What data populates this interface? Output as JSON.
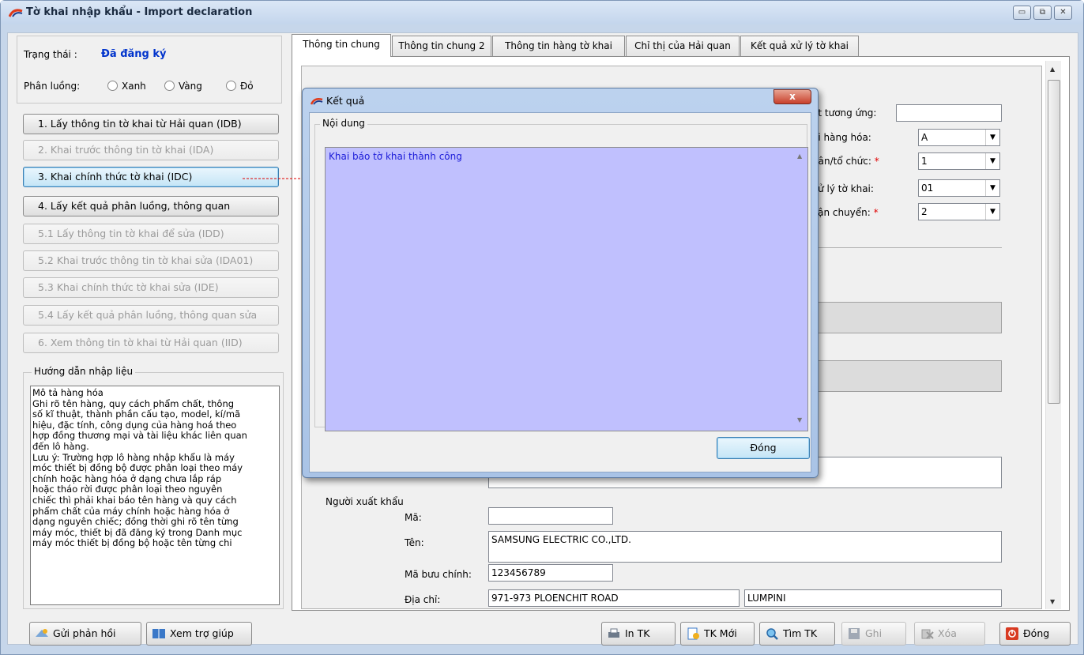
{
  "window": {
    "title": "Tờ khai nhập khẩu - Import declaration",
    "buttons": [
      "▭",
      "⧉",
      "✕"
    ]
  },
  "status": {
    "label": "Trạng thái :",
    "value": "Đã đăng ký",
    "routing_label": "Phân luồng:",
    "options": [
      "Xanh",
      "Vàng",
      "Đỏ"
    ]
  },
  "actions": [
    "1. Lấy thông tin tờ khai từ Hải quan (IDB)",
    "2. Khai trước thông tin tờ khai (IDA)",
    "3. Khai chính thức tờ khai (IDC)",
    "4. Lấy kết quả phân luồng, thông quan",
    "5.1 Lấy thông tin tờ khai để sửa (IDD)",
    "5.2 Khai trước thông tin tờ khai sửa (IDA01)",
    "5.3 Khai chính thức tờ khai sửa (IDE)",
    "5.4 Lấy kết quả phân luồng, thông quan sửa",
    "6. Xem thông tin tờ khai từ Hải quan (IID)"
  ],
  "guide": {
    "title": "Hướng dẫn nhập liệu",
    "text": "Mô tả hàng hóa\nGhi rõ tên hàng, quy cách phẩm chất, thông\nsố kĩ thuật, thành phần cấu tạo, model, kí/mã\nhiệu, đặc tính, công dụng của hàng hoá theo\nhợp đồng thương mại và tài liệu khác liên quan\nđến lô hàng.\nLưu ý: Trường hợp lô hàng nhập khẩu là máy\nmóc thiết bị đồng bộ được phân loại theo máy\nchính hoặc hàng hóa ở dạng chưa lắp ráp\nhoặc tháo rời được phân loại theo nguyên\nchiếc thì phải khai báo tên hàng và quy cách\nphẩm chất của máy chính hoặc hàng hóa ở\ndạng nguyên chiếc; đồng thời ghi rõ tên từng\nmáy móc, thiết bị đã đăng ký trong Danh mục\nmáy móc thiết bị đồng bộ hoặc tên từng chi"
  },
  "tabs": [
    "Thông tin chung",
    "Thông tin chung 2",
    "Thông tin hàng tờ khai",
    "Chỉ thị của Hải quan",
    "Kết quả xử lý tờ khai"
  ],
  "form": {
    "f1_label": "ết tương ứng:",
    "f2_label": "ại hàng hóa:",
    "f2_value": "A",
    "f3_label": "hân/tổ chức:",
    "f3_value": "1",
    "f4_label": "xử lý tờ khai:",
    "f4_value": "01",
    "f5_label": "vận chuyển:",
    "f5_value": "2",
    "required": "*",
    "exporter": {
      "section": "Người xuất khẩu",
      "code_label": "Mã:",
      "code_value": "",
      "name_label": "Tên:",
      "name_value": "SAMSUNG ELECTRIC CO.,LTD.",
      "postal_label": "Mã bưu chính:",
      "postal_value": "123456789",
      "address_label": "Địa chỉ:",
      "address1": "971-973 PLOENCHIT ROAD",
      "address2": "LUMPINI"
    }
  },
  "dialog": {
    "title": "Kết quả",
    "close": "x",
    "group": "Nội dung",
    "message": "Khai báo tờ khai thành công",
    "ok": "Đóng"
  },
  "bottom": {
    "feedback": "Gửi phản hồi",
    "help": "Xem trợ giúp",
    "print": "In TK",
    "new": "TK Mới",
    "search": "Tìm TK",
    "save": "Ghi",
    "delete": "Xóa",
    "close": "Đóng"
  },
  "colors": {
    "accent": "#0033cc",
    "arrow": "#e00000",
    "content_bg": "#c0c0fe"
  }
}
